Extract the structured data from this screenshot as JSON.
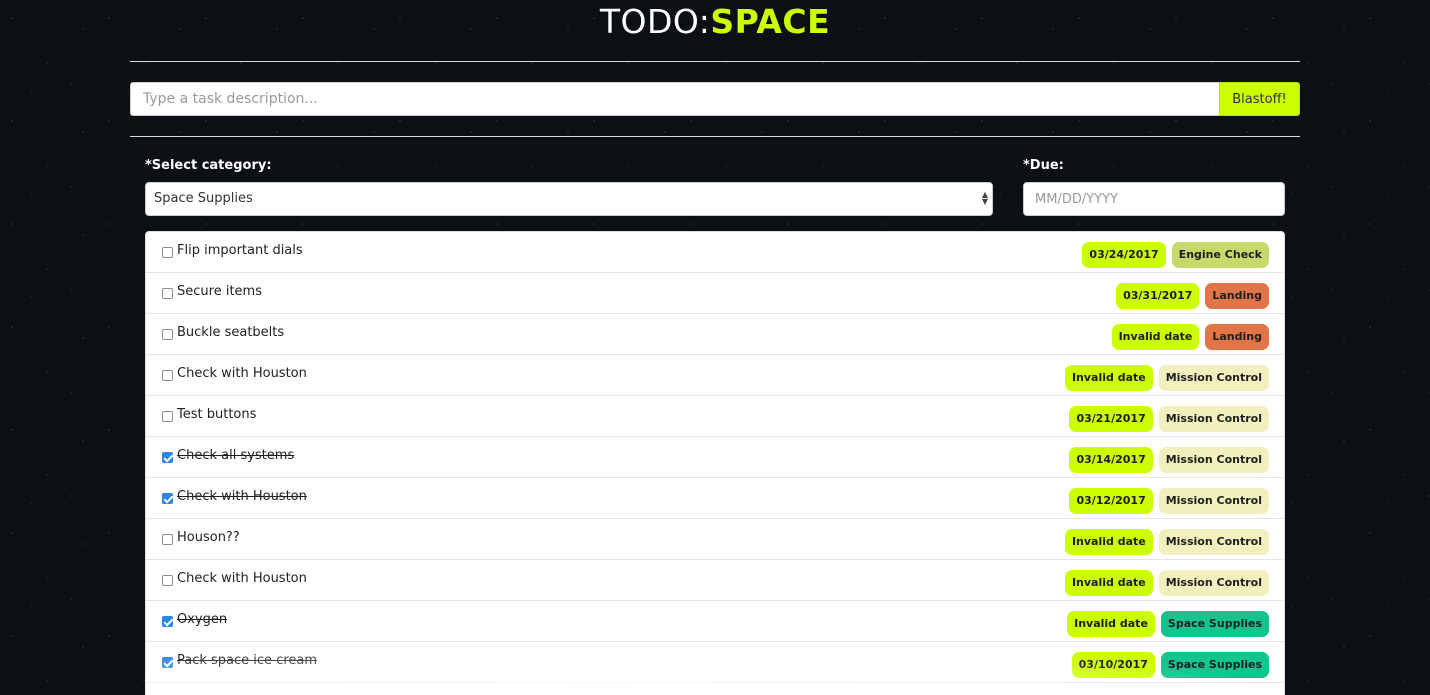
{
  "app": {
    "title_prefix": "TODO:",
    "title_accent": "SPACE"
  },
  "task_entry": {
    "placeholder": "Type a task description...",
    "submit_label": "Blastoff!"
  },
  "filters": {
    "category_label": "*Select category:",
    "category_value": "Space Supplies",
    "due_label": "*Due:",
    "due_placeholder": "MM/DD/YYYY"
  },
  "colors": {
    "accent": "#ccff00",
    "engine_check": "#c8d96b",
    "landing": "#e07548",
    "mission_control": "#f3f0c0",
    "space_supplies": "#14c48c",
    "checkbox_checked": "#2a86e8"
  },
  "tasks": [
    {
      "text": "Flip important dials",
      "done": false,
      "due": "03/24/2017",
      "category": "Engine Check",
      "cat_class": "cat-engine"
    },
    {
      "text": "Secure items",
      "done": false,
      "due": "03/31/2017",
      "category": "Landing",
      "cat_class": "cat-landing"
    },
    {
      "text": "Buckle seatbelts",
      "done": false,
      "due": "Invalid date",
      "category": "Landing",
      "cat_class": "cat-landing"
    },
    {
      "text": "Check with Houston",
      "done": false,
      "due": "Invalid date",
      "category": "Mission Control",
      "cat_class": "cat-mission"
    },
    {
      "text": "Test buttons",
      "done": false,
      "due": "03/21/2017",
      "category": "Mission Control",
      "cat_class": "cat-mission"
    },
    {
      "text": "Check all systems",
      "done": true,
      "due": "03/14/2017",
      "category": "Mission Control",
      "cat_class": "cat-mission"
    },
    {
      "text": "Check with Houston",
      "done": true,
      "due": "03/12/2017",
      "category": "Mission Control",
      "cat_class": "cat-mission"
    },
    {
      "text": "Houson??",
      "done": false,
      "due": "Invalid date",
      "category": "Mission Control",
      "cat_class": "cat-mission"
    },
    {
      "text": "Check with Houston",
      "done": false,
      "due": "Invalid date",
      "category": "Mission Control",
      "cat_class": "cat-mission"
    },
    {
      "text": "Oxygen",
      "done": true,
      "due": "Invalid date",
      "category": "Space Supplies",
      "cat_class": "cat-supplies"
    },
    {
      "text": "Pack space ice cream",
      "done": true,
      "due": "03/10/2017",
      "category": "Space Supplies",
      "cat_class": "cat-supplies"
    }
  ]
}
